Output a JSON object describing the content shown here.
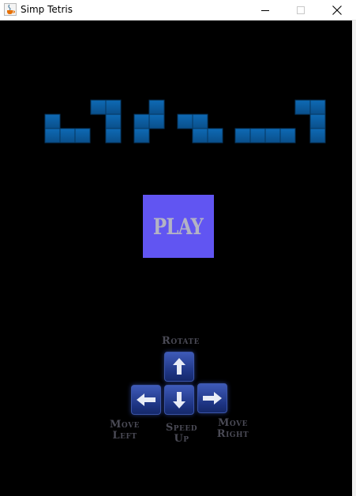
{
  "window": {
    "title": "Simp Tetris",
    "icon": "java-cup-icon",
    "minimize_icon": "minimize-icon",
    "maximize_icon": "maximize-icon",
    "close_icon": "close-icon"
  },
  "logo": {
    "description_icon": "tetromino-pieces-logo",
    "color": "#0b5a9c"
  },
  "play_button": {
    "label": "PLAY",
    "color": "#6155f2"
  },
  "controls": {
    "rotate": {
      "label": "Rotate",
      "icon": "arrow-up-icon"
    },
    "move_left": {
      "label_line1": "Move",
      "label_line2": "Left",
      "icon": "arrow-left-icon"
    },
    "speed_up": {
      "label_line1": "Speed",
      "label_line2": "Up",
      "icon": "arrow-down-icon"
    },
    "move_right": {
      "label_line1": "Move",
      "label_line2": "Right",
      "icon": "arrow-right-icon"
    },
    "key_color": "#2a44a0"
  }
}
